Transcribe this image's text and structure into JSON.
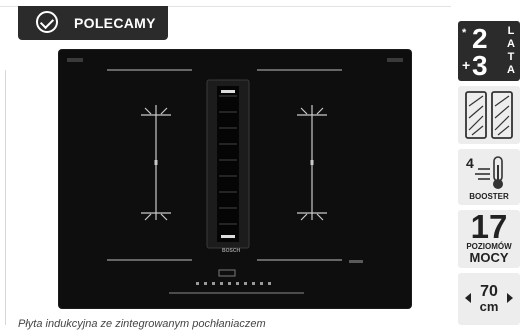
{
  "badge": {
    "label": "POLECAMY",
    "icon": "check-circle-icon"
  },
  "product": {
    "brand": "BOSCH",
    "image_description_icon": "induction-hob-with-extractor",
    "colors": {
      "panel": "#0e0e0e",
      "lines": "#bdbdbd"
    }
  },
  "caption": "Płyta indukcyjna ze zintegrowanym pochłaniaczem",
  "features": {
    "warranty": {
      "star": "*",
      "years_a": "2",
      "plus": "+",
      "years_b": "3",
      "letters": [
        "L",
        "A",
        "T",
        "A"
      ]
    },
    "zones": {
      "icon": "flex-zones-icon"
    },
    "booster": {
      "level": "4",
      "icon": "thermometer-icon",
      "label": "BOOSTER"
    },
    "power": {
      "count": "17",
      "label_a": "POZIOMÓW",
      "label_b": "MOCY"
    },
    "width": {
      "value": "70",
      "unit": "cm"
    }
  }
}
